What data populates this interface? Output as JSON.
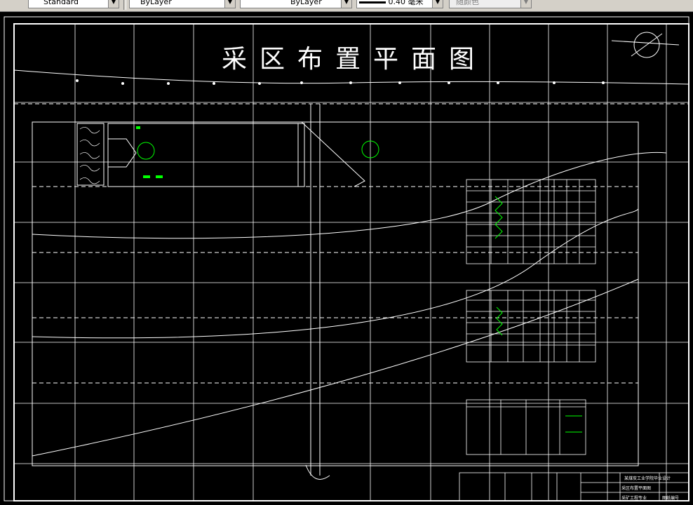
{
  "toolbar": {
    "text_style": "Standard",
    "layer": "ByLayer",
    "linetype": "ByLayer",
    "lineweight": "0.40 毫米",
    "plot_style": "随颜色"
  },
  "drawing": {
    "title": "采区布置平面图",
    "title_chars": [
      "采",
      "区",
      "布",
      "置",
      "平",
      "面",
      "图"
    ],
    "colors": {
      "background": "#000000",
      "line": "#ffffff",
      "highlight": "#00ff00"
    }
  },
  "titleblock": {
    "school": "某煤炭工业学院毕业设计",
    "drawing_name": "采区布置平面图",
    "author": "采矿工程专业",
    "sheet": "图纸编号"
  }
}
